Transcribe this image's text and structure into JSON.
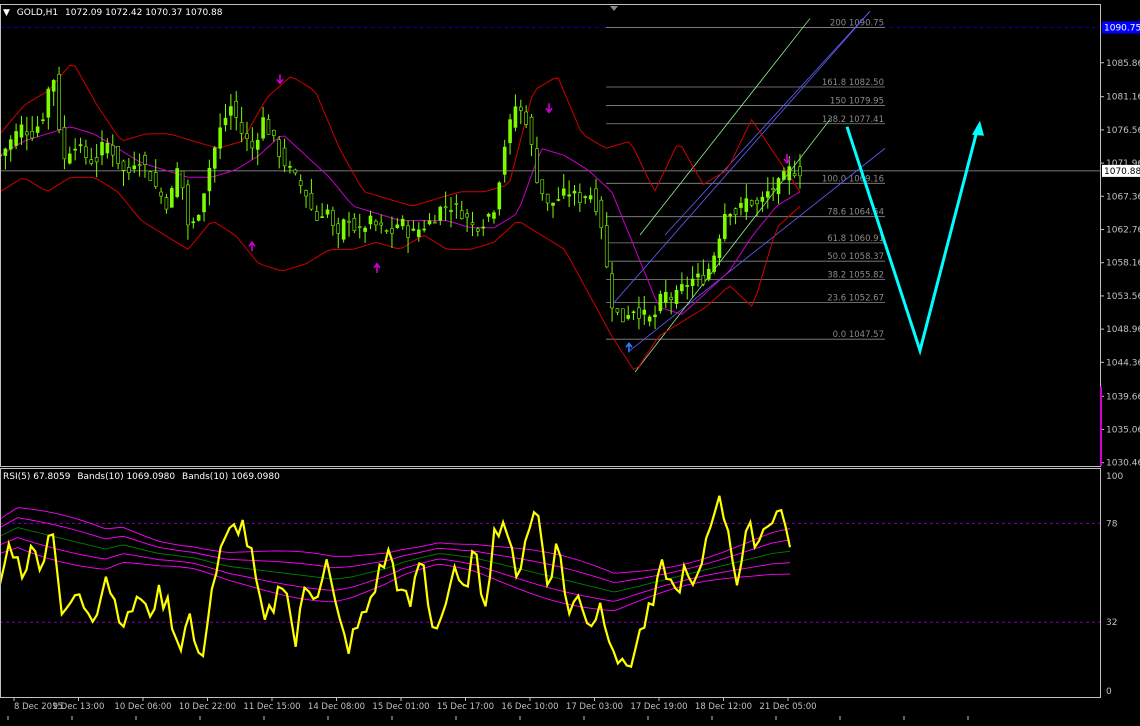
{
  "header": {
    "marker": "▼",
    "symbol": "GOLD,H1",
    "ohlc": "1072.09 1072.42 1070.37 1070.88"
  },
  "indicator_header": {
    "rsi": "RSI(5) 67.8059",
    "bands1": "Bands(10) 1069.0980",
    "bands2": "Bands(10) 1069.0980"
  },
  "colors": {
    "background": "#000000",
    "axis": "#c0c0c0",
    "grid_dashed": "#0000b0",
    "candle": "#7cfc00",
    "bb_upper_lower": "#d00000",
    "bb_mid": "#c800c8",
    "fib": "#8a8a8a",
    "channel_blue": "#6060ff",
    "channel_green": "#90ee90",
    "projection": "#00ffff",
    "rsi": "#ffff00",
    "rsi_bands": "#ff00ff",
    "rsi_mid": "#008000",
    "current_price_box": "#ffffff",
    "target_box": "#0000ff"
  },
  "chart_data": [
    {
      "type": "candlestick",
      "name": "GOLD,H1",
      "y_axis_ticks": [
        "1090.76",
        "1085.86",
        "1081.16",
        "1076.56",
        "1071.96",
        "1067.36",
        "1062.76",
        "1058.16",
        "1053.56",
        "1048.96",
        "1044.36",
        "1039.66",
        "1035.06",
        "1030.46"
      ],
      "x_axis_ticks": [
        "8 Dec 2015",
        "9 Dec 13:00",
        "10 Dec 06:00",
        "10 Dec 22:00",
        "11 Dec 15:00",
        "14 Dec 08:00",
        "15 Dec 01:00",
        "15 Dec 17:00",
        "16 Dec 10:00",
        "17 Dec 03:00",
        "17 Dec 19:00",
        "18 Dec 12:00",
        "21 Dec 05:00"
      ],
      "ylim": [
        1030.0,
        1094.0
      ],
      "current_price": "1070.88",
      "target_price": "1090.75",
      "price_path": [
        1073,
        1075,
        1077,
        1076,
        1078,
        1085,
        1072,
        1075,
        1073,
        1072,
        1075,
        1073,
        1070,
        1073,
        1071,
        1068,
        1066,
        1072,
        1062,
        1066,
        1072,
        1077,
        1080,
        1076,
        1074,
        1078,
        1075,
        1072,
        1070,
        1068,
        1064,
        1066,
        1061,
        1065,
        1062,
        1064,
        1063,
        1062,
        1064,
        1062,
        1063,
        1064,
        1066,
        1066,
        1065,
        1063,
        1064,
        1066,
        1075,
        1080,
        1078,
        1070,
        1066,
        1067,
        1068,
        1067,
        1068,
        1065,
        1053,
        1050,
        1052,
        1051,
        1050,
        1054,
        1053,
        1055,
        1056,
        1056,
        1060,
        1066,
        1065,
        1067,
        1066,
        1068,
        1069,
        1071,
        1070.88
      ],
      "bollinger_upper_path": [
        1076,
        1080,
        1082,
        1086,
        1080,
        1075,
        1076,
        1076,
        1075,
        1074,
        1075,
        1081,
        1084,
        1082,
        1074,
        1068,
        1067,
        1066,
        1067,
        1068,
        1068,
        1069,
        1082,
        1084,
        1076,
        1074,
        1075,
        1068,
        1075,
        1069,
        1071,
        1078,
        1073,
        1068
      ],
      "bollinger_lower_path": [
        1068,
        1070,
        1068,
        1070,
        1070,
        1068,
        1064,
        1062,
        1060,
        1064,
        1062,
        1058,
        1057,
        1058,
        1060,
        1060,
        1061,
        1060,
        1062,
        1060,
        1060,
        1061,
        1064,
        1062,
        1060,
        1054,
        1048,
        1043,
        1048,
        1050,
        1052,
        1055,
        1052,
        1063,
        1066
      ],
      "bollinger_mid_path": [
        1073,
        1075,
        1076,
        1077,
        1076,
        1074,
        1072,
        1071,
        1070,
        1070,
        1071,
        1073,
        1076,
        1073,
        1070,
        1066,
        1065,
        1064,
        1064,
        1064,
        1063,
        1063,
        1065,
        1074,
        1073,
        1071,
        1068,
        1060,
        1052,
        1051,
        1054,
        1057,
        1062,
        1066,
        1068
      ],
      "fibonacci_levels": [
        {
          "label": "200",
          "value": "1090.75"
        },
        {
          "label": "161.8",
          "value": "1082.50"
        },
        {
          "label": "150",
          "value": "1079.95"
        },
        {
          "label": "138.2",
          "value": "1077.41"
        },
        {
          "label": "100.0",
          "value": "1069.16"
        },
        {
          "label": "78.6",
          "value": "1064.54"
        },
        {
          "label": "61.8",
          "value": "1060.91"
        },
        {
          "label": "50.0",
          "value": "1058.37"
        },
        {
          "label": "38.2",
          "value": "1055.82"
        },
        {
          "label": "23.6",
          "value": "1052.67"
        },
        {
          "label": "0.0",
          "value": "1047.57"
        }
      ],
      "fractal_up_marks": [
        1083,
        1079,
        1072
      ],
      "fractal_down_marks": [
        1061,
        1058,
        1047
      ],
      "projection_path": [
        1077.0,
        1046.0,
        1077.0
      ]
    },
    {
      "type": "line",
      "name": "RSI(5)",
      "value": "67.8059",
      "y_axis_ticks": [
        "100",
        "78",
        "32",
        "0"
      ],
      "levels": [
        78,
        32
      ],
      "ylim": [
        0,
        100
      ],
      "rsi_path": [
        50,
        70,
        55,
        65,
        60,
        78,
        30,
        45,
        40,
        35,
        55,
        40,
        30,
        45,
        35,
        45,
        40,
        20,
        35,
        10,
        45,
        65,
        75,
        78,
        60,
        30,
        40,
        55,
        20,
        50,
        45,
        60,
        35,
        20,
        30,
        40,
        55,
        65,
        45,
        40,
        65,
        30,
        35,
        55,
        45,
        65,
        40,
        75,
        80,
        50,
        75,
        85,
        50,
        70,
        35,
        45,
        30,
        40,
        25,
        10,
        15,
        30,
        40,
        60,
        45,
        55,
        45,
        70,
        90,
        80,
        50,
        75,
        70,
        80,
        85,
        70
      ],
      "rsi_band_path": [
        72,
        76,
        74,
        72,
        70,
        68,
        66,
        68,
        66,
        64,
        63,
        62,
        60,
        58,
        57,
        56,
        55,
        54,
        53,
        52,
        53,
        55,
        57,
        60,
        62,
        64,
        63,
        62,
        60,
        58,
        56,
        54,
        52,
        50,
        48,
        46,
        48,
        50,
        52,
        54,
        56,
        58,
        60,
        62,
        64,
        65
      ]
    }
  ]
}
